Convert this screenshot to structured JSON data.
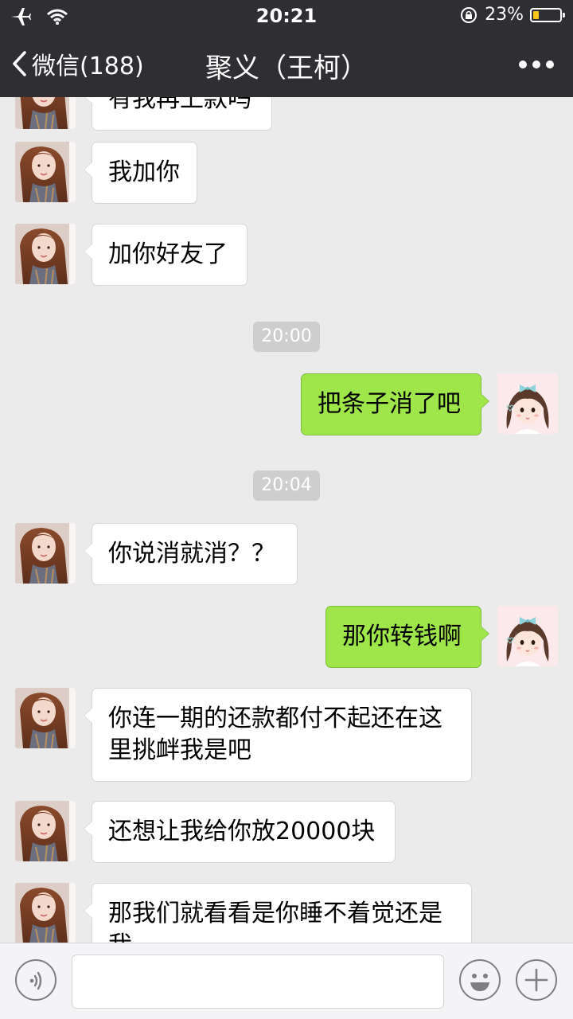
{
  "status_bar": {
    "time": "20:21",
    "battery": "23%",
    "battery_level": 0.23,
    "icons": [
      "airplane-icon",
      "wifi-icon",
      "orientation-lock-icon",
      "battery-icon"
    ]
  },
  "nav": {
    "back_label": "微信(188)",
    "title": "聚义（王柯）",
    "more_icon": "more-dots-icon"
  },
  "messages": [
    {
      "type": "in",
      "text": "有我再上款吗"
    },
    {
      "type": "in",
      "text": "我加你"
    },
    {
      "type": "in",
      "text": "加你好友了"
    },
    {
      "type": "time",
      "text": "20:00"
    },
    {
      "type": "out",
      "text": "把条子消了吧"
    },
    {
      "type": "time",
      "text": "20:04"
    },
    {
      "type": "in",
      "text": "你说消就消？？"
    },
    {
      "type": "out",
      "text": "那你转钱啊"
    },
    {
      "type": "in",
      "text": "你连一期的还款都付不起还在这里挑衅我是吧"
    },
    {
      "type": "in",
      "text": "还想让我给你放20000块"
    },
    {
      "type": "in",
      "text": "那我们就看看是你睡不着觉还是我"
    }
  ],
  "input_bar": {
    "value": "",
    "icons": [
      "voice-icon",
      "emoji-icon",
      "plus-icon"
    ]
  },
  "colors": {
    "header_bg": "#2e2e33",
    "chat_bg": "#ebebeb",
    "outgoing_bubble": "#9ee64a",
    "incoming_bubble": "#ffffff",
    "timestamp_bg": "#cecece"
  }
}
